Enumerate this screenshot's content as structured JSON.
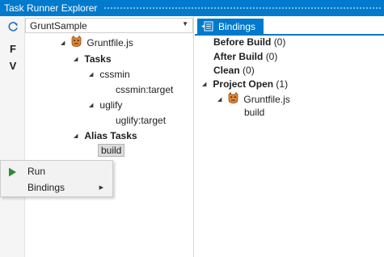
{
  "window": {
    "title": "Task Runner Explorer"
  },
  "toolbar": {
    "refresh_icon": "refresh-icon",
    "f_label": "F",
    "v_label": "V"
  },
  "project_selector": {
    "value": "GruntSample"
  },
  "task_tree": {
    "root": "Gruntfile.js",
    "tasks_header": "Tasks",
    "cssmin": "cssmin",
    "cssmin_target": "cssmin:target",
    "uglify": "uglify",
    "uglify_target": "uglify:target",
    "alias_header": "Alias Tasks",
    "build": "build"
  },
  "bindings_panel": {
    "tab_label": "Bindings",
    "before_build": {
      "label": "Before Build",
      "count": "(0)"
    },
    "after_build": {
      "label": "After Build",
      "count": "(0)"
    },
    "clean": {
      "label": "Clean",
      "count": "(0)"
    },
    "project_open": {
      "label": "Project Open",
      "count": "(1)"
    },
    "project_open_file": "Gruntfile.js",
    "project_open_task": "build"
  },
  "context_menu": {
    "run": "Run",
    "bindings": "Bindings"
  },
  "colors": {
    "accent": "#007acc",
    "run_green": "#2e8b3a",
    "grunt_orange": "#e48632"
  }
}
